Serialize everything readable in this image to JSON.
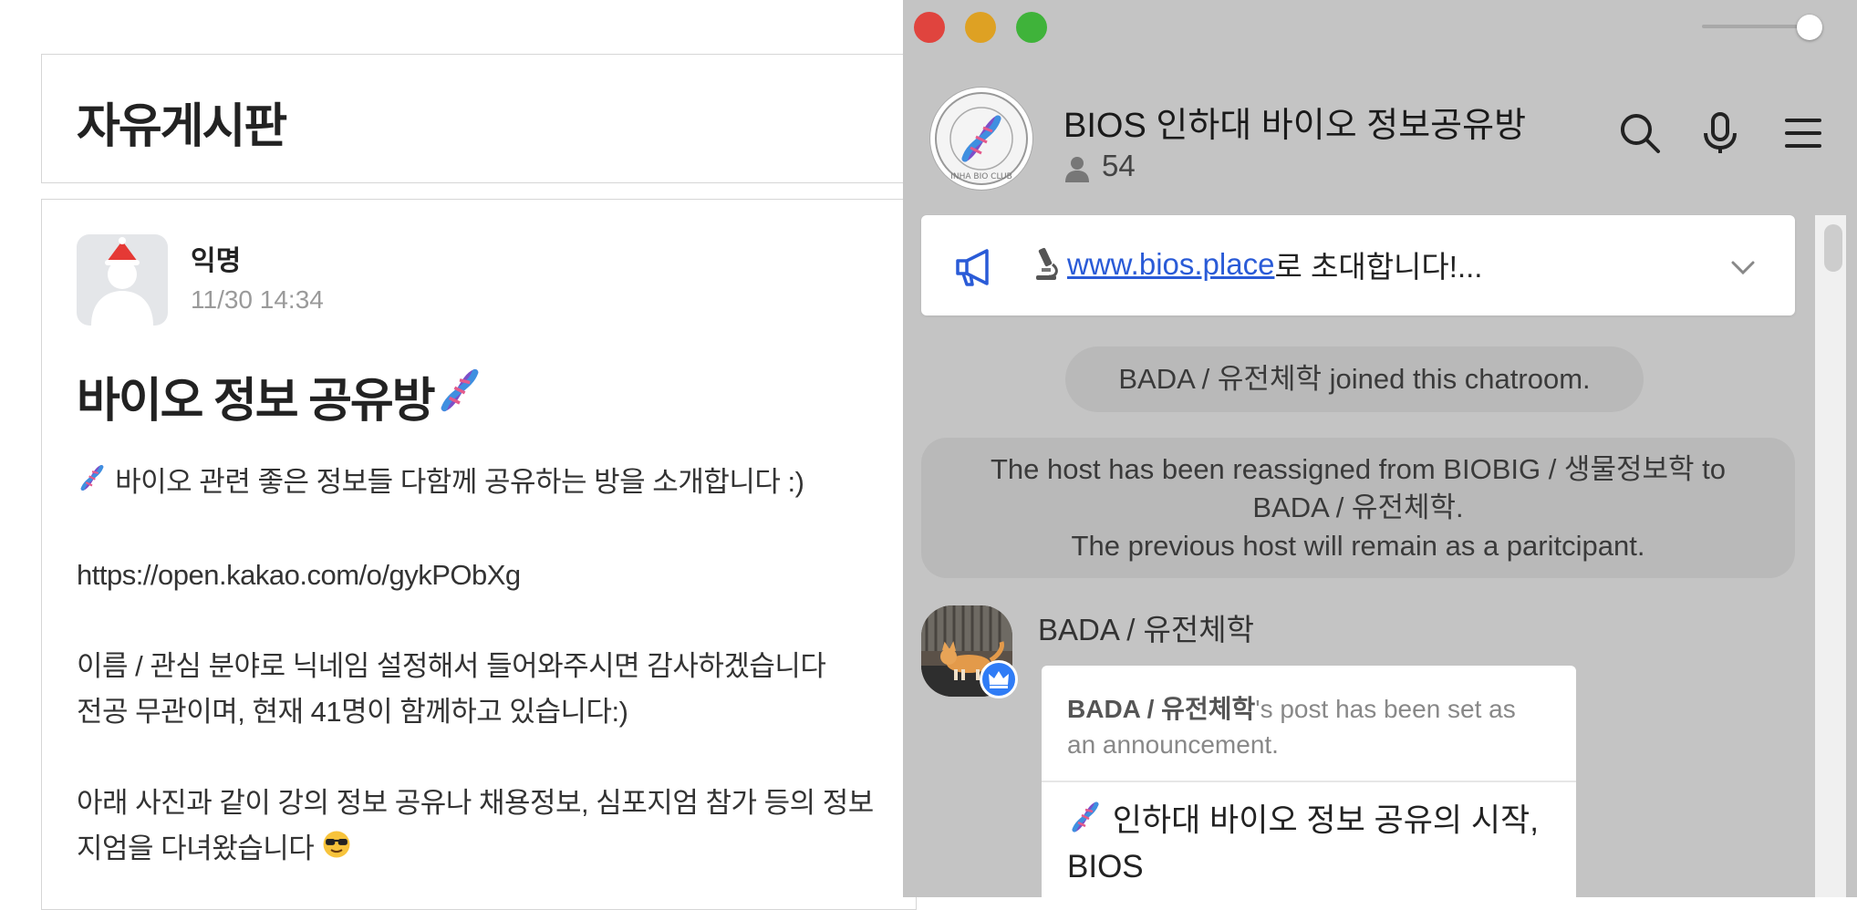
{
  "board": {
    "title": "자유게시판",
    "post": {
      "author": "익명",
      "date": "11/30 14:34",
      "title": "바이오 정보 공유방",
      "lines": [
        "바이오 관련 좋은 정보들 다함께 공유하는 방을 소개합니다 :)",
        "https://open.kakao.com/o/gykPObXg",
        "이름 / 관심 분야로 닉네임 설정해서 들어와주시면 감사하겠습니다",
        "전공 무관이며, 현재 41명이 함께하고 있습니다:)",
        "아래 사진과 같이 강의 정보 공유나 채용정보, 심포지엄 참가 등의 정보",
        "지엄을 다녀왔습니다"
      ]
    }
  },
  "chat": {
    "room_name": "BIOS 인하대 바이오 정보공유방",
    "member_count": "54",
    "room_avatar_text": "INHA BIO CLUB",
    "notice": {
      "link": "www.bios.place",
      "text": " 로 초대합니다!..."
    },
    "system_join": "BADA / 유전체학 joined this chatroom.",
    "system_host": [
      "The host has been reassigned from BIOBIG / 생물정보학 to",
      "BADA / 유전체학.",
      "The previous host will remain as a paritcipant."
    ],
    "message": {
      "sender": "BADA / 유전체학",
      "announcement_bold": "BADA / 유전체학",
      "announcement_rest": "'s post has been set as an announcement.",
      "body_line1": "인하대 바이오 정보 공유의 시작,",
      "body_line2": "BIOS"
    }
  },
  "colors": {
    "chat_bg": "#c4c4c4",
    "link": "#2a5bd7",
    "host_badge": "#2f7cf6",
    "close": "#e0443e",
    "minimize": "#dea123",
    "maximize": "#3fb33a"
  },
  "icons": [
    "dna-icon",
    "search-icon",
    "microphone-icon",
    "menu-icon",
    "megaphone-icon",
    "microscope-icon",
    "chevron-down-icon",
    "person-icon",
    "crown-icon",
    "sunglasses-emoji"
  ]
}
